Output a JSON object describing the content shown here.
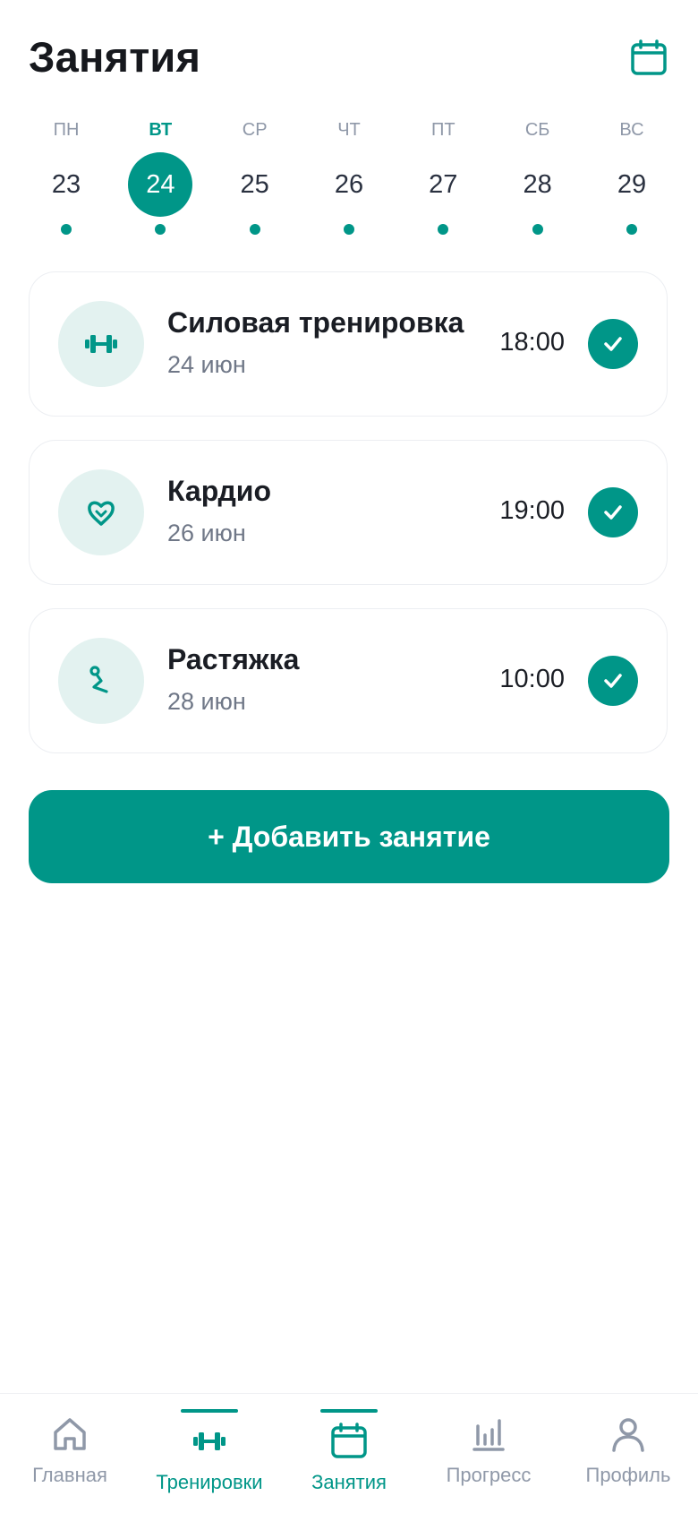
{
  "header": {
    "title": "Занятия"
  },
  "week": [
    {
      "name": "ПН",
      "num": "23"
    },
    {
      "name": "ВТ",
      "num": "24"
    },
    {
      "name": "СР",
      "num": "25"
    },
    {
      "name": "ЧТ",
      "num": "26"
    },
    {
      "name": "ПТ",
      "num": "27"
    },
    {
      "name": "СБ",
      "num": "28"
    },
    {
      "name": "ВС",
      "num": "29"
    }
  ],
  "sessions": [
    {
      "title": "Силовая тренировка",
      "date": "24 июн",
      "time": "18:00",
      "icon": "dumbbell-icon",
      "done": true
    },
    {
      "title": "Кардио",
      "date": "26 июн",
      "time": "19:00",
      "icon": "heart-icon",
      "done": true
    },
    {
      "title": "Растяжка",
      "date": "28 июн",
      "time": "10:00",
      "icon": "stretch-icon",
      "done": true
    }
  ],
  "add_button": {
    "label": "+ Добавить занятие"
  },
  "tabs": [
    {
      "label": "Главная",
      "icon": "home-icon"
    },
    {
      "label": "Тренировки",
      "icon": "dumbbell-icon"
    },
    {
      "label": "Занятия",
      "icon": "calendar-icon"
    },
    {
      "label": "Прогресс",
      "icon": "chart-icon"
    },
    {
      "label": "Профиль",
      "icon": "profile-icon"
    }
  ],
  "colors": {
    "accent": "#009688",
    "accent_light": "#e3f2f0",
    "muted": "#8f98a8"
  }
}
